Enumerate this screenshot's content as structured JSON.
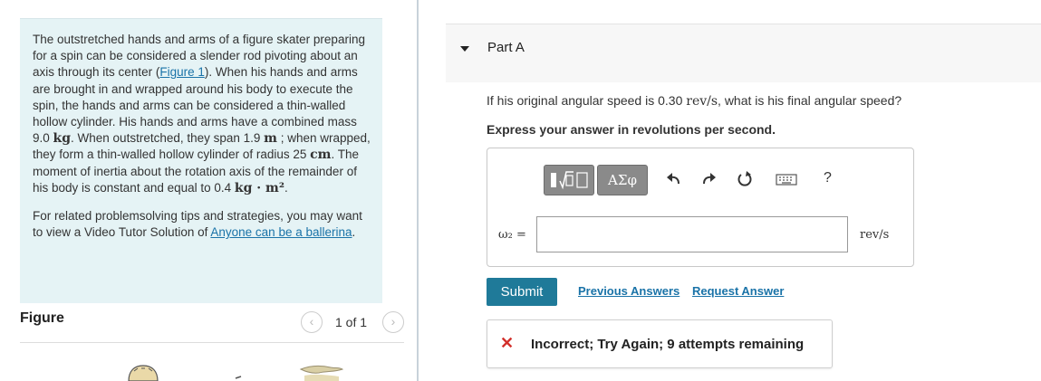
{
  "problem": {
    "paragraph1_parts": [
      "The outstretched hands and arms of a figure skater preparing for a spin can be considered a slender rod pivoting about an axis through its center (",
      "Figure 1",
      "). When his hands and arms are brought in and wrapped around his body to execute the spin, the hands and arms can be considered a thin-walled hollow cylinder. His hands and arms have a combined mass 9.0 ",
      "kg",
      ". When outstretched, they span 1.9 ",
      "m",
      " ; when wrapped, they form a thin-walled hollow cylinder of radius 25 ",
      "cm",
      ". The moment of inertia about the rotation axis of the remainder of his body is constant and equal to 0.4 ",
      "kg · m²",
      "."
    ],
    "paragraph2_text": "For related problemsolving tips and strategies, you may want to view a Video Tutor Solution of ",
    "paragraph2_link": "Anyone can be a ballerina",
    "paragraph2_end": "."
  },
  "figure": {
    "title": "Figure",
    "counter": "1 of 1",
    "prev_icon": "chevron-left-icon",
    "next_icon": "chevron-right-icon"
  },
  "part": {
    "title": "Part A",
    "question_prefix": "If his original angular speed is 0.30 ",
    "question_unit": "rev/s",
    "question_suffix": ", what is his final angular speed?",
    "instruction": "Express your answer in revolutions per second."
  },
  "answer": {
    "variable_label": "ω₂ =",
    "input_value": "",
    "unit": "rev/s",
    "toolbar": {
      "templates_icon": "templates-icon",
      "greek_label": "ΑΣφ",
      "undo_icon": "undo-icon",
      "redo_icon": "redo-icon",
      "reset_icon": "reset-icon",
      "keyboard_icon": "keyboard-icon",
      "help_label": "?"
    }
  },
  "actions": {
    "submit": "Submit",
    "previous_answers": "Previous Answers",
    "request_answer": "Request Answer"
  },
  "feedback": {
    "icon": "x-icon",
    "mark": "✕",
    "text": "Incorrect; Try Again; 9 attempts remaining"
  },
  "colors": {
    "problem_bg": "#e5f3f5",
    "link": "#1a73a8",
    "submit_bg": "#1f7a99",
    "error": "#d2302b",
    "toolbar_button": "#8a8a8a"
  }
}
